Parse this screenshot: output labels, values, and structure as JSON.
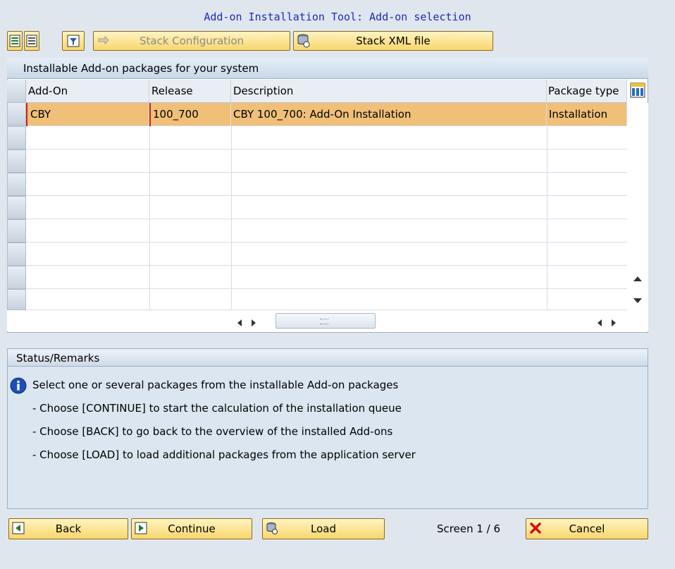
{
  "window": {
    "title": "Add-on Installation Tool: Add-on selection"
  },
  "toolbar": {
    "stack_configuration_label": "Stack Configuration",
    "stack_xml_file_label": "Stack XML file"
  },
  "table": {
    "panel_title": "Installable Add-on packages for your system",
    "columns": [
      "Add-On",
      "Release",
      "Description",
      "Package type"
    ],
    "rows": [
      {
        "addon": "CBY",
        "release": "100_700",
        "description": "CBY 100_700: Add-On Installation",
        "package_type": "Installation",
        "selected": true
      }
    ]
  },
  "status": {
    "title": "Status/Remarks",
    "info_line": "Select one or several packages from the installable Add-on packages",
    "lines": [
      "- Choose [CONTINUE] to start the calculation of the installation queue",
      "- Choose [BACK] to go back to the overview of the installed Add-ons",
      "- Choose [LOAD] to load additional packages from the application server"
    ]
  },
  "footer": {
    "back_label": "Back",
    "continue_label": "Continue",
    "load_label": "Load",
    "screen_info": "Screen 1 / 6",
    "cancel_label": "Cancel"
  },
  "colors": {
    "title": "#1e2bb5",
    "selected_row": "#f0c078",
    "button": "#f7d66c"
  }
}
